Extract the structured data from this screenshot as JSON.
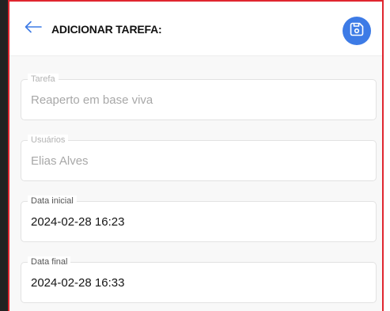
{
  "header": {
    "title": "ADICIONAR TAREFA:",
    "back_icon": "arrow-left-icon",
    "save_icon": "floppy-disk-icon"
  },
  "fields": [
    {
      "label": "Tarefa",
      "value": "Reaperto em base viva",
      "state": "disabled"
    },
    {
      "label": "Usuários",
      "value": "Elias Alves",
      "state": "disabled"
    },
    {
      "label": "Data inicial",
      "value": "2024-02-28 16:23",
      "state": "enabled"
    },
    {
      "label": "Data final",
      "value": "2024-02-28 16:33",
      "state": "enabled"
    }
  ],
  "colors": {
    "accent": "#3d7be6",
    "frame_border": "#e0262f"
  }
}
